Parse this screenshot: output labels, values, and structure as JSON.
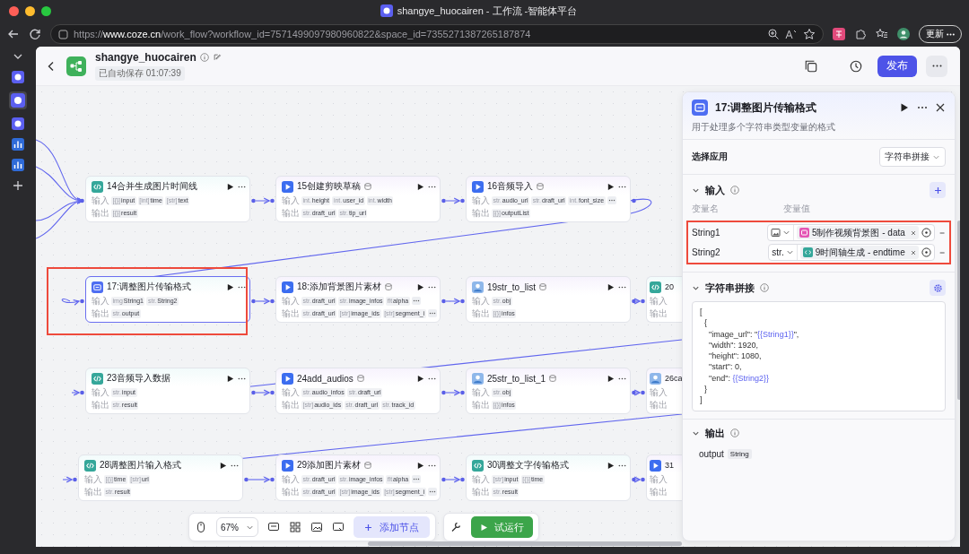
{
  "window": {
    "title": "shangye_huocairen - 工作流 -智能体平台"
  },
  "browser": {
    "url_scheme": "https://",
    "url_host": "www.coze.cn",
    "url_path": "/work_flow?workflow_id=7571499097980960822&space_id=7355271387265187874",
    "update_button": "更新"
  },
  "header": {
    "name": "shangye_huocairen",
    "autosave": "已自动保存 01:07:39",
    "publish": "发布"
  },
  "nodes": [
    {
      "kind": "code",
      "title": "14合并生成图片时间线",
      "plugin_mark": false,
      "selected": false,
      "partial": false,
      "rows": [
        {
          "label": "输入",
          "ports": [
            {
              "type": "[{}]",
              "name": "input"
            },
            {
              "type": "[int]",
              "name": "time"
            },
            {
              "type": "[str]",
              "name": "text"
            }
          ],
          "overflow": false
        },
        {
          "label": "输出",
          "ports": [
            {
              "type": "[{}]",
              "name": "result"
            }
          ],
          "overflow": false
        }
      ]
    },
    {
      "kind": "plugin",
      "title": "15创建剪映草稿",
      "plugin_mark": true,
      "selected": false,
      "partial": false,
      "rows": [
        {
          "label": "输入",
          "ports": [
            {
              "type": "int.",
              "name": "height"
            },
            {
              "type": "int.",
              "name": "user_id"
            },
            {
              "type": "int.",
              "name": "width"
            }
          ],
          "overflow": false
        },
        {
          "label": "输出",
          "ports": [
            {
              "type": "str.",
              "name": "draft_url"
            },
            {
              "type": "str.",
              "name": "tip_url"
            }
          ],
          "overflow": false
        }
      ]
    },
    {
      "kind": "plugin",
      "title": "16音频导入",
      "plugin_mark": true,
      "selected": false,
      "partial": false,
      "rows": [
        {
          "label": "输入",
          "ports": [
            {
              "type": "str.",
              "name": "audio_url"
            },
            {
              "type": "str.",
              "name": "draft_url"
            },
            {
              "type": "int.",
              "name": "font_size"
            }
          ],
          "overflow": true
        },
        {
          "label": "输出",
          "ports": [
            {
              "type": "[{}]",
              "name": "outputList"
            }
          ],
          "overflow": false
        }
      ]
    },
    {
      "kind": "text",
      "title": "17:调整图片传输格式",
      "plugin_mark": false,
      "selected": true,
      "partial": false,
      "rows": [
        {
          "label": "输入",
          "ports": [
            {
              "type": "img",
              "name": "String1"
            },
            {
              "type": "str.",
              "name": "String2"
            }
          ],
          "overflow": false
        },
        {
          "label": "输出",
          "ports": [
            {
              "type": "str.",
              "name": "output"
            }
          ],
          "overflow": false
        }
      ]
    },
    {
      "kind": "plugin",
      "title": "18:添加背景图片素材",
      "plugin_mark": true,
      "selected": false,
      "partial": false,
      "rows": [
        {
          "label": "输入",
          "ports": [
            {
              "type": "str.",
              "name": "draft_url"
            },
            {
              "type": "str.",
              "name": "image_infos"
            },
            {
              "type": "flt",
              "name": "alpha"
            }
          ],
          "overflow": true
        },
        {
          "label": "输出",
          "ports": [
            {
              "type": "str.",
              "name": "draft_url"
            },
            {
              "type": "[str]",
              "name": "image_ids"
            },
            {
              "type": "[str]",
              "name": "segment_i"
            }
          ],
          "overflow": true
        }
      ]
    },
    {
      "kind": "image",
      "title": "19str_to_list",
      "plugin_mark": true,
      "selected": false,
      "partial": false,
      "rows": [
        {
          "label": "输入",
          "ports": [
            {
              "type": "str.",
              "name": "obj"
            }
          ],
          "overflow": false
        },
        {
          "label": "输出",
          "ports": [
            {
              "type": "[{}]",
              "name": "infos"
            }
          ],
          "overflow": false
        }
      ]
    },
    {
      "kind": "code",
      "title": "20",
      "plugin_mark": false,
      "selected": false,
      "partial": true,
      "rows": [
        {
          "label": "输入",
          "ports": [],
          "overflow": false
        },
        {
          "label": "输出",
          "ports": [],
          "overflow": false
        }
      ]
    },
    {
      "kind": "code",
      "title": "23音频导入数据",
      "plugin_mark": false,
      "selected": false,
      "partial": false,
      "rows": [
        {
          "label": "输入",
          "ports": [
            {
              "type": "str.",
              "name": "input"
            }
          ],
          "overflow": false
        },
        {
          "label": "输出",
          "ports": [
            {
              "type": "str.",
              "name": "result"
            }
          ],
          "overflow": false
        }
      ]
    },
    {
      "kind": "plugin",
      "title": "24add_audios",
      "plugin_mark": true,
      "selected": false,
      "partial": false,
      "rows": [
        {
          "label": "输入",
          "ports": [
            {
              "type": "str.",
              "name": "audio_infos"
            },
            {
              "type": "str.",
              "name": "draft_url"
            }
          ],
          "overflow": false
        },
        {
          "label": "输出",
          "ports": [
            {
              "type": "[str]",
              "name": "audio_ids"
            },
            {
              "type": "str.",
              "name": "draft_url"
            },
            {
              "type": "str.",
              "name": "track_id"
            }
          ],
          "overflow": false
        }
      ]
    },
    {
      "kind": "image",
      "title": "25str_to_list_1",
      "plugin_mark": true,
      "selected": false,
      "partial": false,
      "rows": [
        {
          "label": "输入",
          "ports": [
            {
              "type": "str.",
              "name": "obj"
            }
          ],
          "overflow": false
        },
        {
          "label": "输出",
          "ports": [
            {
              "type": "[{}]",
              "name": "infos"
            }
          ],
          "overflow": false
        }
      ]
    },
    {
      "kind": "image",
      "title": "26ca",
      "plugin_mark": false,
      "selected": false,
      "partial": true,
      "rows": [
        {
          "label": "输入",
          "ports": [],
          "overflow": false
        },
        {
          "label": "输出",
          "ports": [],
          "overflow": false
        }
      ]
    },
    {
      "kind": "code",
      "title": "28调整图片输入格式",
      "plugin_mark": false,
      "selected": false,
      "partial": false,
      "rows": [
        {
          "label": "输入",
          "ports": [
            {
              "type": "[{}]",
              "name": "time"
            },
            {
              "type": "[str]",
              "name": "url"
            }
          ],
          "overflow": false
        },
        {
          "label": "输出",
          "ports": [
            {
              "type": "str.",
              "name": "result"
            }
          ],
          "overflow": false
        }
      ]
    },
    {
      "kind": "plugin",
      "title": "29添加图片素材",
      "plugin_mark": true,
      "selected": false,
      "partial": false,
      "rows": [
        {
          "label": "输入",
          "ports": [
            {
              "type": "str.",
              "name": "draft_url"
            },
            {
              "type": "str.",
              "name": "image_infos"
            },
            {
              "type": "flt",
              "name": "alpha"
            }
          ],
          "overflow": true
        },
        {
          "label": "输出",
          "ports": [
            {
              "type": "str.",
              "name": "draft_url"
            },
            {
              "type": "[str]",
              "name": "image_ids"
            },
            {
              "type": "[str]",
              "name": "segment_i"
            }
          ],
          "overflow": true
        }
      ]
    },
    {
      "kind": "code",
      "title": "30调整文字传输格式",
      "plugin_mark": false,
      "selected": false,
      "partial": false,
      "rows": [
        {
          "label": "输入",
          "ports": [
            {
              "type": "[str]",
              "name": "input"
            },
            {
              "type": "[{}]",
              "name": "time"
            }
          ],
          "overflow": false
        },
        {
          "label": "输出",
          "ports": [
            {
              "type": "str.",
              "name": "result"
            }
          ],
          "overflow": false
        }
      ]
    },
    {
      "kind": "plugin",
      "title": "31",
      "plugin_mark": false,
      "selected": false,
      "partial": true,
      "rows": [
        {
          "label": "输入",
          "ports": [],
          "overflow": false
        },
        {
          "label": "输出",
          "ports": [],
          "overflow": false
        }
      ]
    }
  ],
  "panel": {
    "title": "17:调整图片传输格式",
    "description": "用于处理多个字符串类型变量的格式",
    "app_label": "选择应用",
    "app_value": "字符串拼接",
    "input_section": {
      "title": "输入",
      "expanded": true,
      "col_name": "变量名",
      "col_value": "变量值",
      "rows": [
        {
          "name": "String1",
          "type": {
            "kind": "image"
          },
          "source": {
            "kind": "image",
            "text": "5制作视频背景图 - data"
          }
        },
        {
          "name": "String2",
          "type": {
            "kind": "text",
            "label": "str."
          },
          "source": {
            "kind": "code",
            "text": "9时间轴生成 - endtime"
          }
        }
      ]
    },
    "template_section": {
      "title": "字符串拼接",
      "expanded": true,
      "lines": [
        [
          {
            "text": "["
          }
        ],
        [
          {
            "text": "  {"
          }
        ],
        [
          {
            "text": "    \"image_url\": \""
          },
          {
            "text": "{{String1}}",
            "kind": "ref"
          },
          {
            "text": "\","
          }
        ],
        [
          {
            "text": "    \"width\": 1920,"
          }
        ],
        [
          {
            "text": "    \"height\": 1080,"
          }
        ],
        [
          {
            "text": "    \"start\": 0,"
          }
        ],
        [
          {
            "text": "    \"end\": "
          },
          {
            "text": "{{String2}}",
            "kind": "ref"
          }
        ],
        [
          {
            "text": "  }"
          }
        ],
        [
          {
            "text": "]"
          }
        ]
      ]
    },
    "output_section": {
      "title": "输出",
      "expanded": true,
      "name": "output",
      "type": "String"
    }
  },
  "toolbar": {
    "zoom": "67%",
    "add_node": "添加节点",
    "test_run": "试运行"
  }
}
